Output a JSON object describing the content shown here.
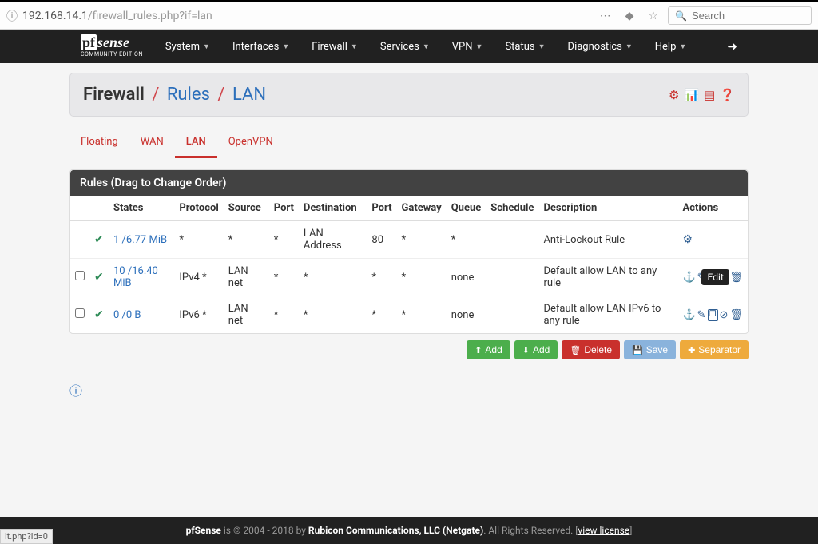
{
  "browser": {
    "url_host": "192.168.14.1",
    "url_path": "/firewall_rules.php?if=lan",
    "search_placeholder": "Search"
  },
  "logo": {
    "main": "sense",
    "pf": "pf",
    "sub": "COMMUNITY EDITION"
  },
  "nav": [
    "System",
    "Interfaces",
    "Firewall",
    "Services",
    "VPN",
    "Status",
    "Diagnostics",
    "Help"
  ],
  "title": {
    "part1": "Firewall",
    "part2": "Rules",
    "part3": "LAN"
  },
  "tabs": [
    "Floating",
    "WAN",
    "LAN",
    "OpenVPN"
  ],
  "active_tab_index": 2,
  "panel_title": "Rules (Drag to Change Order)",
  "columns": [
    "",
    "",
    "States",
    "Protocol",
    "Source",
    "Port",
    "Destination",
    "Port",
    "Gateway",
    "Queue",
    "Schedule",
    "Description",
    "Actions"
  ],
  "rows": [
    {
      "checkbox": false,
      "states": "1 /6.77 MiB",
      "protocol": "*",
      "source": "*",
      "sport": "*",
      "dest": "LAN Address",
      "dport": "80",
      "gateway": "*",
      "queue": "*",
      "schedule": "",
      "desc": "Anti-Lockout Rule",
      "action_type": "gear"
    },
    {
      "checkbox": true,
      "states": "10 /16.40 MiB",
      "protocol": "IPv4 *",
      "source": "LAN net",
      "sport": "*",
      "dest": "*",
      "dport": "*",
      "gateway": "*",
      "queue": "none",
      "schedule": "",
      "desc": "Default allow LAN to any rule",
      "action_type": "full",
      "tooltip": "Edit"
    },
    {
      "checkbox": true,
      "states": "0 /0 B",
      "protocol": "IPv6 *",
      "source": "LAN net",
      "sport": "*",
      "dest": "*",
      "dport": "*",
      "gateway": "*",
      "queue": "none",
      "schedule": "",
      "desc": "Default allow LAN IPv6 to any rule",
      "action_type": "full"
    }
  ],
  "buttons": {
    "add1": "Add",
    "add2": "Add",
    "delete": "Delete",
    "save": "Save",
    "separator": "Separator"
  },
  "footer": {
    "product": "pfSense",
    "copyright": " is © 2004 - 2018 by ",
    "company": "Rubicon Communications, LLC (Netgate)",
    "rights": ". All Rights Reserved. ",
    "view": "view license"
  },
  "status_corner": "it.php?id=0"
}
